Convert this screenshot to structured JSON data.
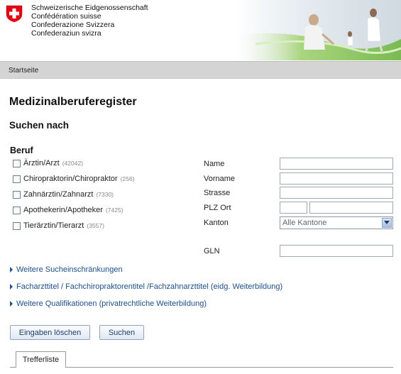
{
  "header": {
    "confederation": [
      "Schweizerische Eidgenossenschaft",
      "Confédération suisse",
      "Confederazione Svizzera",
      "Confederaziun svizra"
    ]
  },
  "breadcrumb": "Startseite",
  "page_title": "Medizinalberuferegister",
  "section_title": "Suchen nach",
  "beruf": {
    "title": "Beruf",
    "items": [
      {
        "label": "Ärztin/Arzt",
        "count": "(42042)",
        "checked": false
      },
      {
        "label": "Chiropraktorin/Chiropraktor",
        "count": "(256)",
        "checked": false
      },
      {
        "label": "Zahnärztin/Zahnarzt",
        "count": "(7330)",
        "checked": false
      },
      {
        "label": "Apothekerin/Apotheker",
        "count": "(7425)",
        "checked": false
      },
      {
        "label": "Tierärztin/Tierarzt",
        "count": "(3557)",
        "checked": false
      }
    ]
  },
  "fields": {
    "name_label": "Name",
    "vorname_label": "Vorname",
    "strasse_label": "Strasse",
    "plz_ort_label": "PLZ Ort",
    "kanton_label": "Kanton",
    "kanton_value": "Alle Kantone",
    "gln_label": "GLN"
  },
  "expanders": [
    "Weitere Sucheinschränkungen",
    "Facharzttitel / Fachchiropraktorentitel /Fachzahnarzttitel (eidg. Weiterbildung)",
    "Weitere Qualifikationen (privatrechtliche Weiterbildung)"
  ],
  "buttons": {
    "clear": "Eingaben löschen",
    "search": "Suchen"
  },
  "tabs": {
    "results": "Trefferliste"
  },
  "colors": {
    "link": "#1e4f88",
    "breadcrumb_bar": "#d4d4d4",
    "swiss_red": "#e30613"
  }
}
